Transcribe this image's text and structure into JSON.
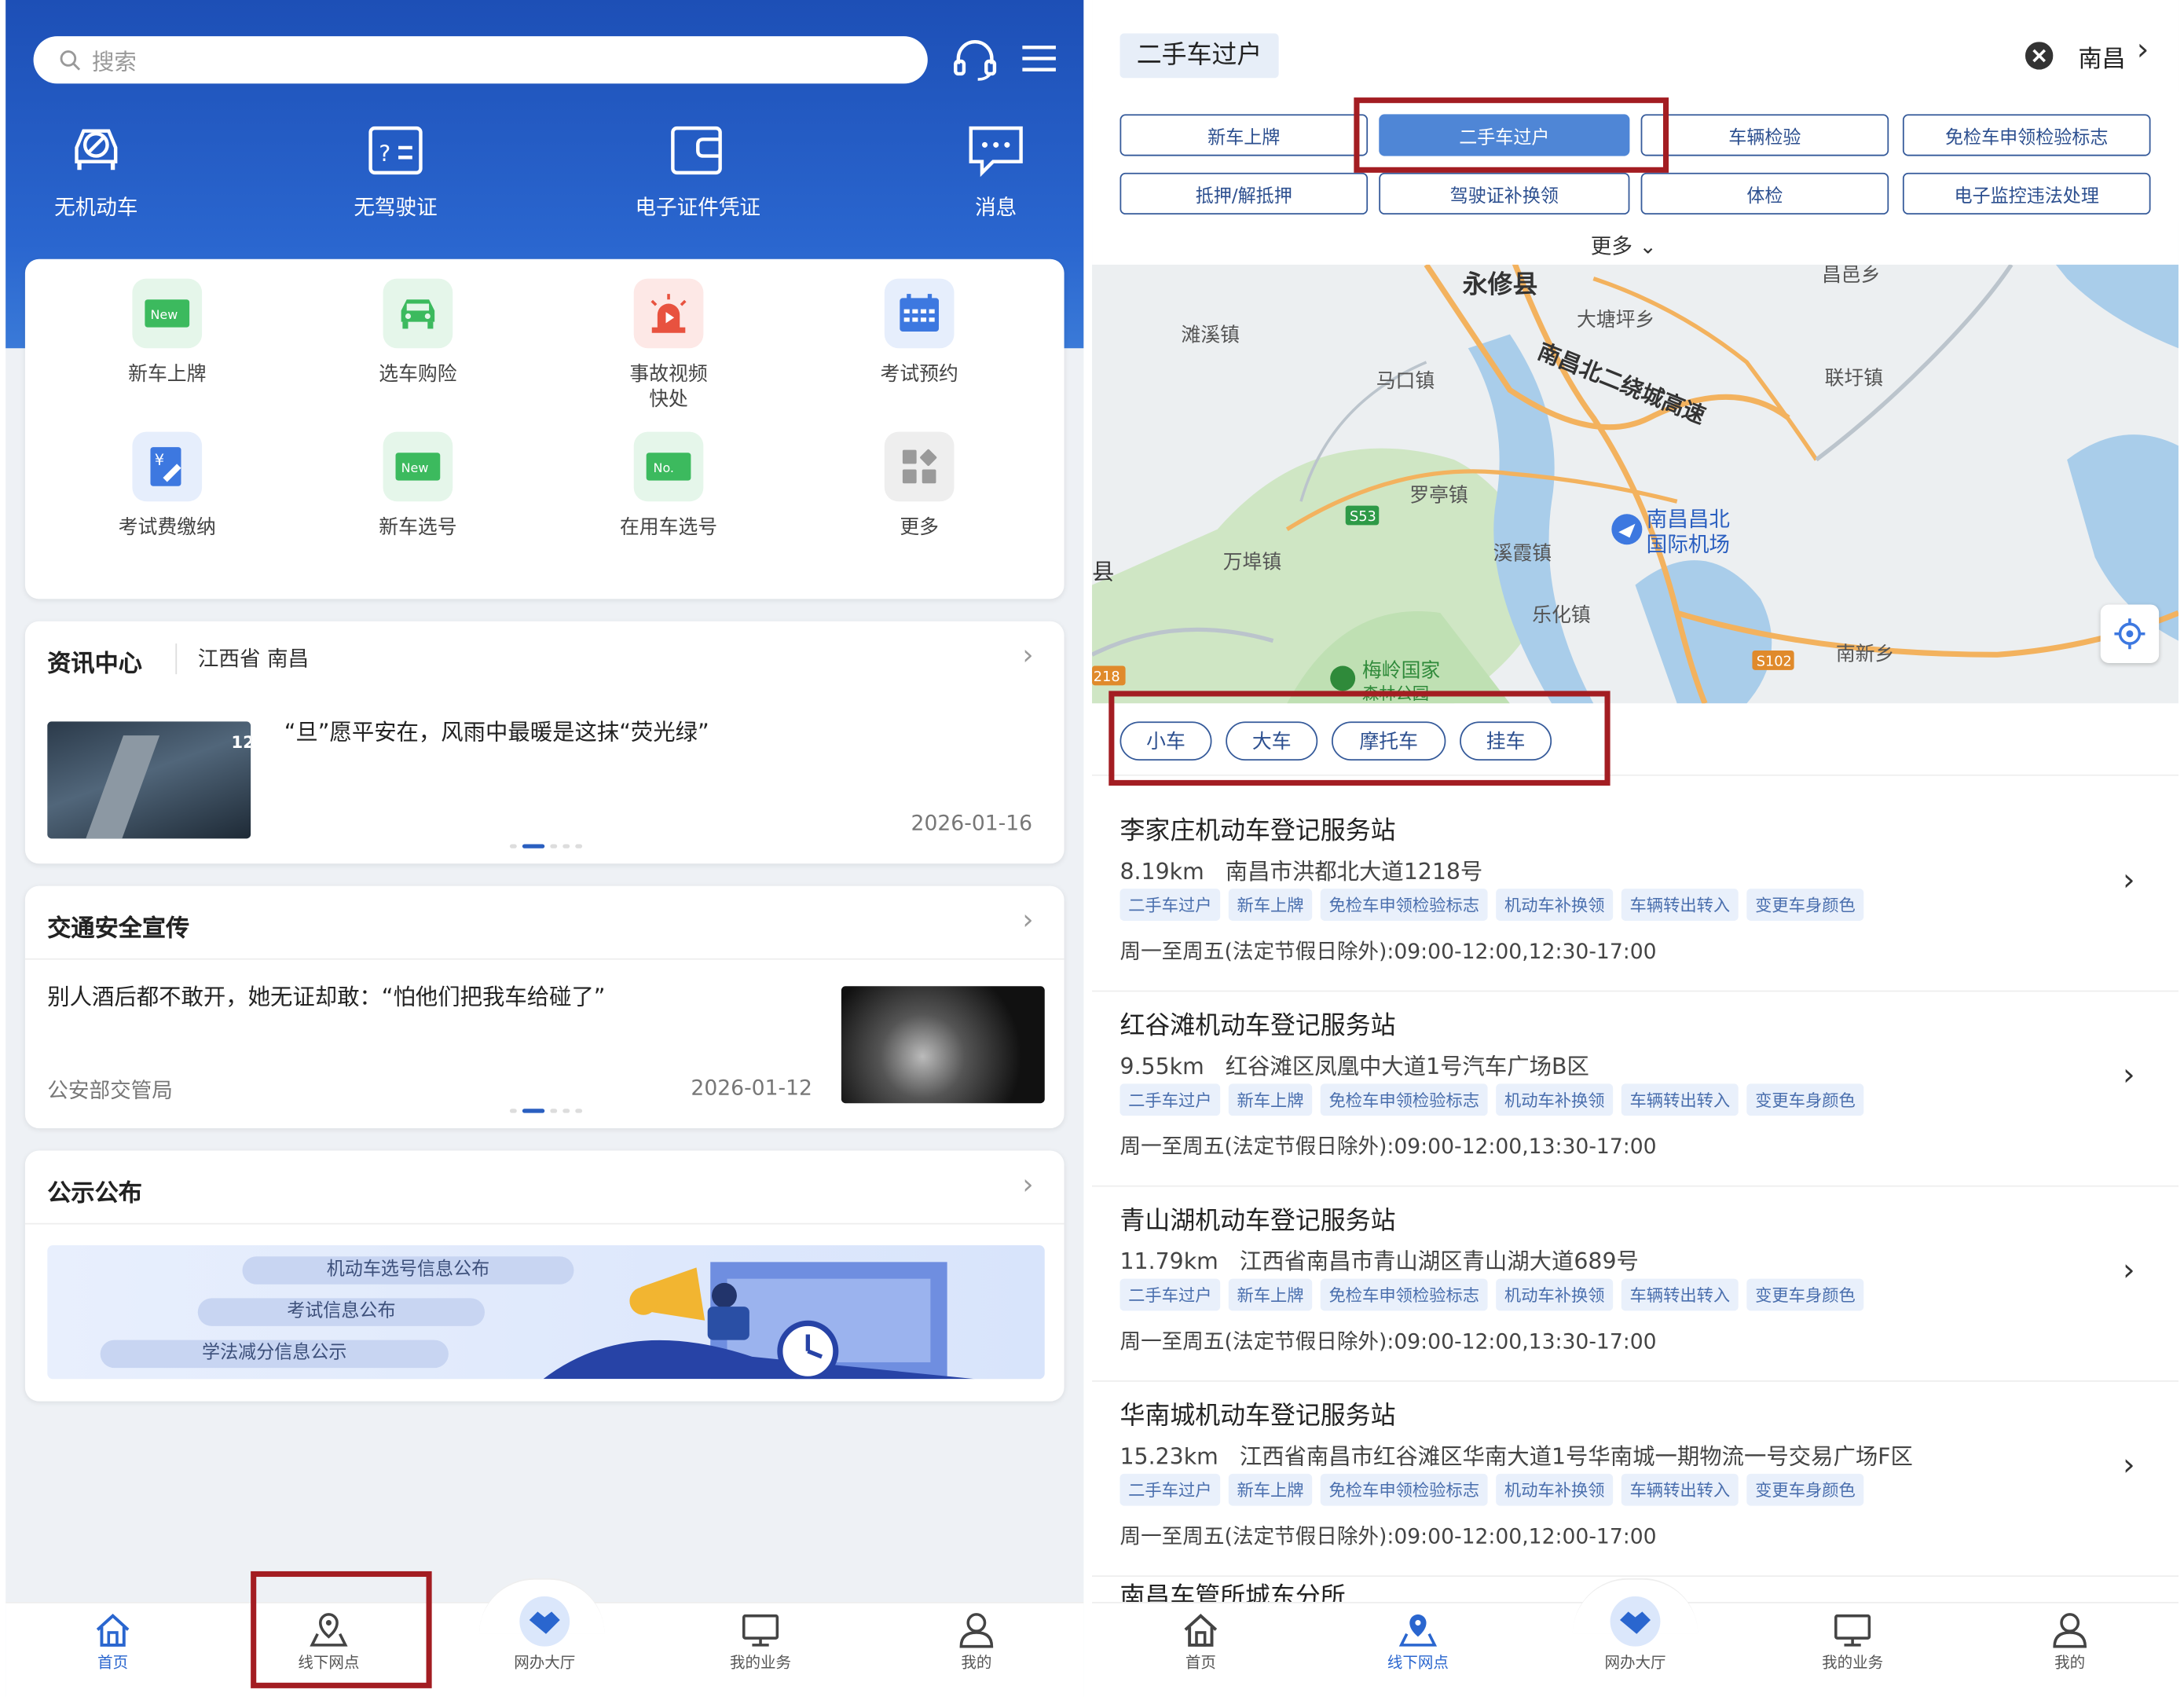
{
  "left": {
    "search_placeholder": "搜索",
    "top_tiles": [
      "无机动车",
      "无驾驶证",
      "电子证件凭证",
      "消息"
    ],
    "services": [
      {
        "label": "新车上牌",
        "badge": "New"
      },
      {
        "label": "选车购险"
      },
      {
        "label": "事故视频快处",
        "line1": "事故视频",
        "line2": "快处"
      },
      {
        "label": "考试预约"
      },
      {
        "label": "考试费缴纳",
        "badge": "¥"
      },
      {
        "label": "新车选号",
        "badge": "New"
      },
      {
        "label": "在用车选号",
        "badge": "No."
      },
      {
        "label": "更多"
      }
    ],
    "news": {
      "title": "资讯中心",
      "location": "江西省 南昌",
      "headline": "“旦”愿平安在，风雨中最暖是这抹“荧光绿”",
      "date": "2026-01-16",
      "thumb_text": "12"
    },
    "safety": {
      "title": "交通安全宣传",
      "headline": "别人酒后都不敢开，她无证却敢：“怕他们把我车给碰了”",
      "source": "公安部交管局",
      "date": "2026-01-12"
    },
    "notice": {
      "title": "公示公布",
      "items": [
        "机动车选号信息公布",
        "考试信息公布",
        "学法减分信息公示"
      ]
    },
    "tabs": [
      "首页",
      "线下网点",
      "网办大厅",
      "我的业务",
      "我的"
    ]
  },
  "right": {
    "service_tag": "二手车过户",
    "city": "南昌",
    "chips": [
      "新车上牌",
      "二手车过户",
      "车辆检验",
      "免检车申领检验标志",
      "抵押/解抵押",
      "驾驶证补换领",
      "体检",
      "电子监控违法处理"
    ],
    "more": "更多",
    "map_labels": [
      "永修县",
      "滩溪镇",
      "大塘坪乡",
      "马口镇",
      "南昌北二绕城高速",
      "联圩镇",
      "罗亭镇",
      "S53",
      "南昌昌北",
      "国际机场",
      "县",
      "万埠镇",
      "溪霞镇",
      "乐化镇",
      "梅岭国家",
      "218",
      "S102",
      "南新乡",
      "昌邑乡",
      "森林公园"
    ],
    "vehicle_types": [
      "小车",
      "大车",
      "摩托车",
      "挂车"
    ],
    "stations": [
      {
        "name": "李家庄机动车登记服务站",
        "distance": "8.19km",
        "address": "南昌市洪都北大道1218号",
        "hours": "周一至周五(法定节假日除外):09:00-12:00,12:30-17:00"
      },
      {
        "name": "红谷滩机动车登记服务站",
        "distance": "9.55km",
        "address": "红谷滩区凤凰中大道1号汽车广场B区",
        "hours": "周一至周五(法定节假日除外):09:00-12:00,13:30-17:00"
      },
      {
        "name": "青山湖机动车登记服务站",
        "distance": "11.79km",
        "address": "江西省南昌市青山湖区青山湖大道689号",
        "hours": "周一至周五(法定节假日除外):09:00-12:00,13:30-17:00"
      },
      {
        "name": "华南城机动车登记服务站",
        "distance": "15.23km",
        "address": "江西省南昌市红谷滩区华南大道1号华南城一期物流一号交易广场F区",
        "hours": "周一至周五(法定节假日除外):09:00-12:00,12:00-17:00"
      }
    ],
    "station_tags": [
      "二手车过户",
      "新车上牌",
      "免检车申领检验标志",
      "机动车补换领",
      "车辆转出转入",
      "变更车身颜色"
    ],
    "partial_station": "南昌车管所城东分所",
    "tabs": [
      "首页",
      "线下网点",
      "网办大厅",
      "我的业务",
      "我的"
    ]
  },
  "colors": {
    "primary": "#2a66cf",
    "highlight_box": "#a31d22",
    "chip_active": "#4f86d6"
  }
}
